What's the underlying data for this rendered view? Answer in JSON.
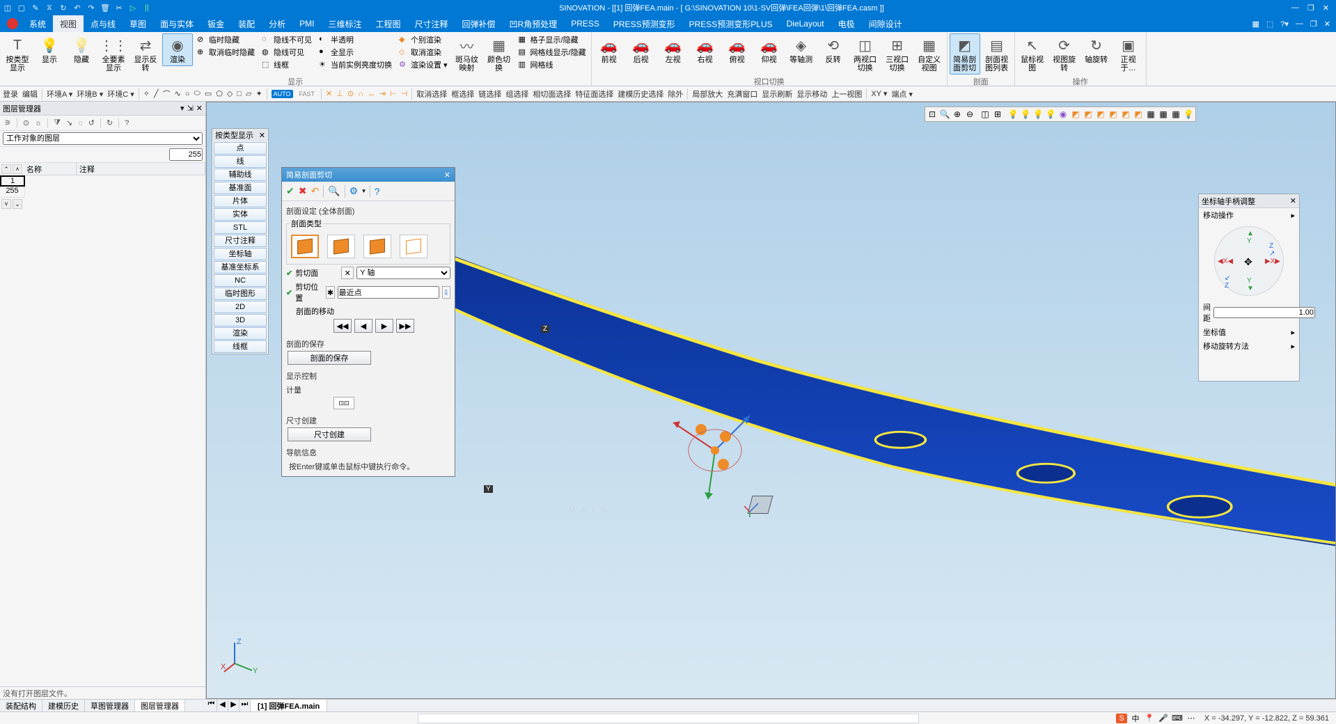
{
  "app": {
    "title": "SINOVATION - [[1] 回弹FEA.main - [ G:\\SINOVATION 10\\1-SV回弹\\FEA回弹\\1\\回弹FEA.casm ]]"
  },
  "menu": {
    "items": [
      "系统",
      "视图",
      "点与线",
      "草图",
      "面与实体",
      "钣金",
      "装配",
      "分析",
      "PMI",
      "三维标注",
      "工程图",
      "尺寸注释",
      "回弹补偿",
      "凹R角预处理",
      "PRESS",
      "PRESS预测变形",
      "PRESS预测变形PLUS",
      "DieLayout",
      "电极",
      "间隙设计"
    ],
    "active_index": 1
  },
  "ribbon": {
    "group_display": "显示",
    "group_viewport": "视口切换",
    "group_section": "剖面",
    "group_operate": "操作",
    "btns": {
      "type_display": "按类型显示",
      "show": "显示",
      "hide": "隐藏",
      "show_all": "全要素显示",
      "reverse": "显示反转",
      "render": "渲染",
      "temp_hide": "临时隐藏",
      "untemp_hide": "取消临时隐藏",
      "hide_invisible": "隐线不可见",
      "hide_visible": "隐线可见",
      "wire": "线框",
      "semi": "半透明",
      "full": "全显示",
      "cur_lum": "当前实例亮度切换",
      "ind_render": "个别渲染",
      "cancel_render": "取消渲染",
      "render_set": "渲染设置",
      "zebra": "斑马纹映射",
      "color": "颜色切换",
      "grid_show": "格子显示/隐藏",
      "mesh_show": "网格线显示/隐藏",
      "mesh_line": "网格线",
      "front": "前视",
      "back": "后视",
      "left": "左视",
      "right": "右视",
      "top": "俯视",
      "bottom": "仰视",
      "iso": "等轴测",
      "invert": "反转",
      "two_vp": "两视口切换",
      "three_vp": "三视口切换",
      "custom_vp": "自定义视图",
      "sec_cut": "简易剖面剪切",
      "sec_list": "剖面视图列表",
      "mouse_view": "鼠标视图",
      "view_rot": "视图旋转",
      "axis_rot": "轴旋转",
      "front2": "正视于…"
    }
  },
  "aux": {
    "items_left": [
      "登录",
      "编辑"
    ],
    "env": [
      "环境A",
      "环境B",
      "环境C"
    ],
    "cmds": [
      "取消选择",
      "框选择",
      "链选择",
      "组选择",
      "相切面选择",
      "特征面选择",
      "建模历史选择",
      "除外",
      "局部放大",
      "充满窗口",
      "显示刷新",
      "显示移动",
      "上一视图",
      "XY",
      "端点"
    ]
  },
  "layer_panel": {
    "title": "图层管理器",
    "dropdown": "工作对象的图层",
    "value": "255",
    "cols": {
      "name": "名称",
      "note": "注释"
    },
    "rows": [
      {
        "num": "1",
        "name": "",
        "note": ""
      },
      {
        "num": "255",
        "name": "",
        "note": ""
      }
    ],
    "footer": "没有打开图层文件。"
  },
  "bottom_tabs_left": [
    "装配结构",
    "建模历史",
    "草图管理器",
    "图层管理器"
  ],
  "bottom_tabs_left_active": 3,
  "view_tab": "[1] 回弹FEA.main",
  "cat_panel": {
    "title": "按类型显示",
    "items": [
      "点",
      "线",
      "辅助线",
      "基准面",
      "片体",
      "实体",
      "STL",
      "尺寸注释",
      "坐标轴",
      "基准坐标系",
      "NC",
      "临时图形",
      "2D",
      "3D",
      "渲染",
      "线框"
    ]
  },
  "dialog": {
    "title": "简易剖面剪切",
    "section_setting": "剖面设定 (全体剖面)",
    "section_type": "剖面类型",
    "cut_plane": "剪切面",
    "cut_plane_val": "Y 轴",
    "cut_pos": "剪切位置",
    "cut_pos_val": "最近点",
    "sec_move": "剖面的移动",
    "sec_save_title": "剖面的保存",
    "sec_save_btn": "剖面的保存",
    "disp_ctrl": "显示控制",
    "measure": "计量",
    "dim_create_title": "尺寸创建",
    "dim_create_btn": "尺寸创建",
    "nav_title": "导航信息",
    "nav_msg": "按Enter键或单击鼠标中键执行命令。"
  },
  "handle_panel": {
    "title": "坐标轴手柄调整",
    "move_op": "移动操作",
    "dist": "间距",
    "dist_val": "1.00",
    "coord_val": "坐标值",
    "move_rot": "移动旋转方法"
  },
  "triad": {
    "main": "M A I N"
  },
  "status": {
    "coords": "X =   -34.297, Y =   -12.822, Z =    59.361",
    "tray_badge": "S",
    "tray_cn": "中"
  }
}
